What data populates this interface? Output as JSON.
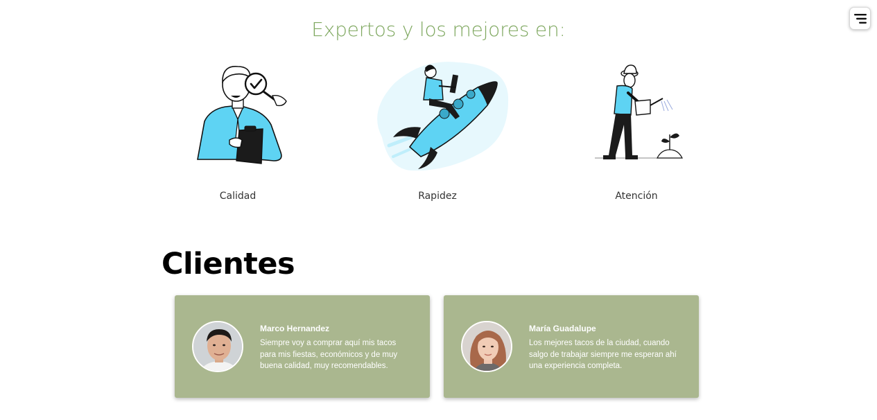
{
  "menu": {
    "icon": "menu-lines-icon"
  },
  "features": {
    "title": "Expertos y los mejores en:",
    "items": [
      {
        "label": "Calidad",
        "icon": "quality-inspector-illustration"
      },
      {
        "label": "Rapidez",
        "icon": "rocket-rider-illustration"
      },
      {
        "label": "Atención",
        "icon": "gardener-watering-illustration"
      }
    ]
  },
  "clients": {
    "title": "Clientes",
    "testimonials": [
      {
        "name": "Marco Hernandez",
        "quote": "Siempre voy a comprar aquí mis tacos para mis fiestas, económicos y de muy buena calidad, muy recomendables."
      },
      {
        "name": "María Guadalupe",
        "quote": "Los mejores tacos de la ciudad, cuando salgo de trabajar siempre me esperan ahí una experiencia completa."
      }
    ]
  },
  "colors": {
    "title_green": "#7fa860",
    "card_bg": "#aab78f",
    "accent_blue": "#5ed3f3"
  }
}
